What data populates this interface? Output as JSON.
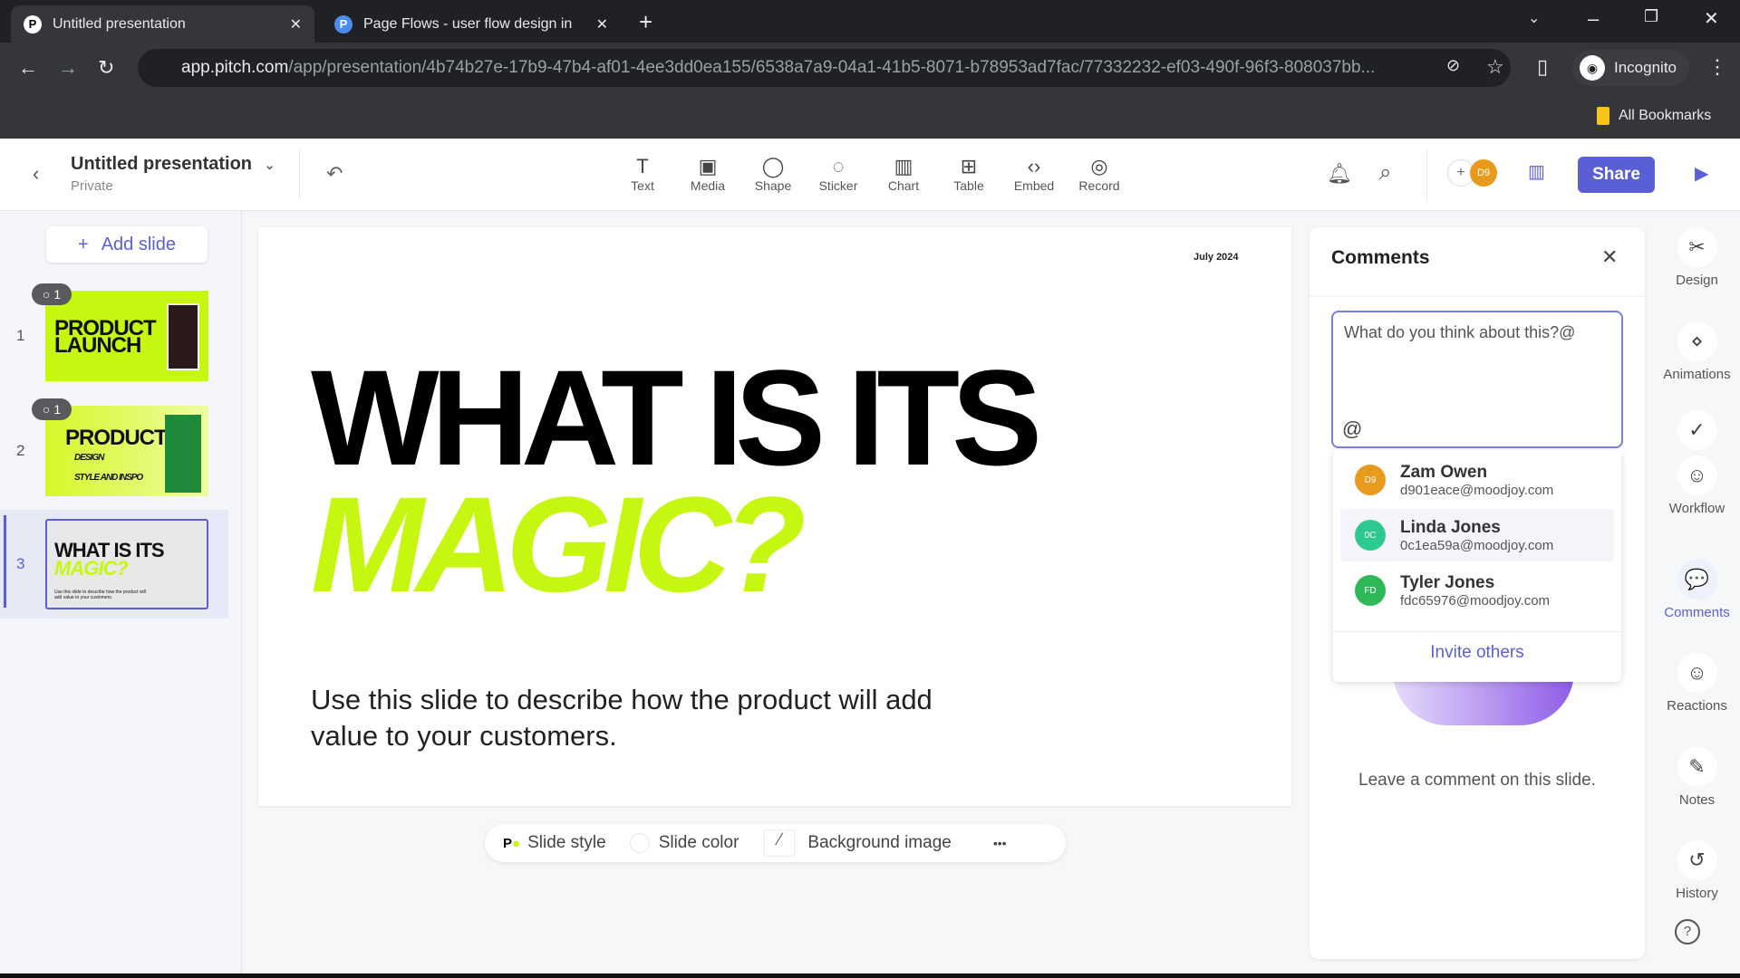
{
  "browser": {
    "tabs": [
      {
        "title": "Untitled presentation",
        "favicon": "P"
      },
      {
        "title": "Page Flows - user flow design in",
        "favicon": "P"
      }
    ],
    "url_host": "app.pitch.com",
    "url_path": "/app/presentation/4b74b27e-17b9-47b4-af01-4ee3dd0ea155/6538a7a9-04a1-41b5-8071-b78953ad7fac/77332232-ef03-490f-96f3-808037bb...",
    "profile": "Incognito",
    "bookmarks": "All Bookmarks"
  },
  "app": {
    "title": "Untitled presentation",
    "visibility": "Private",
    "tools": [
      {
        "label": "Text",
        "icon": "T"
      },
      {
        "label": "Media",
        "icon": "▣"
      },
      {
        "label": "Shape",
        "icon": "◯"
      },
      {
        "label": "Sticker",
        "icon": "◌"
      },
      {
        "label": "Chart",
        "icon": "▥"
      },
      {
        "label": "Table",
        "icon": "⊞"
      },
      {
        "label": "Embed",
        "icon": "‹›"
      },
      {
        "label": "Record",
        "icon": "◎"
      }
    ],
    "share": "Share",
    "avatar_initials": "D9",
    "accent": "#5b5fd6"
  },
  "sidebar": {
    "add_slide": "Add slide",
    "slides": [
      {
        "num": "1",
        "comments": "1",
        "title": "PRODUCT LAUNCH"
      },
      {
        "num": "2",
        "comments": "1",
        "title": "PRODUCT",
        "sub1": "DESIGN",
        "sub2": "STYLE AND INSPO"
      },
      {
        "num": "3",
        "title1": "WHAT IS ITS",
        "title2": "MAGIC?",
        "body": "Use this slide to describe how the product will add value to your customers."
      }
    ],
    "selected": 3
  },
  "slide": {
    "date": "July 2024",
    "heading1": "WHAT IS ITS",
    "heading2": "MAGIC?",
    "body": "Use this slide to describe how the product will add value to your customers.",
    "lime": "#c6f711"
  },
  "bottom_toolbar": {
    "slide_style": "Slide style",
    "slide_color": "Slide color",
    "background_image": "Background image",
    "more": "•••"
  },
  "comments": {
    "title": "Comments",
    "input_value": "What do you think about this?@",
    "at": "@",
    "mentions": [
      {
        "initials": "D9",
        "name": "Zam Owen",
        "email": "d901eace@moodjoy.com",
        "color": "#e89a1c"
      },
      {
        "initials": "0C",
        "name": "Linda Jones",
        "email": "0c1ea59a@moodjoy.com",
        "color": "#2ec98f"
      },
      {
        "initials": "FD",
        "name": "Tyler Jones",
        "email": "fdc65976@moodjoy.com",
        "color": "#2fb858"
      }
    ],
    "invite": "Invite others",
    "empty": "Leave a comment on this slide."
  },
  "rail": [
    {
      "label": "Design",
      "icon": "✂"
    },
    {
      "label": "Animations",
      "icon": "⋄"
    },
    {
      "label": "Workflow",
      "icon": "☺"
    },
    {
      "label": "Comments",
      "icon": "💬"
    },
    {
      "label": "Reactions",
      "icon": "☺"
    },
    {
      "label": "Notes",
      "icon": "✎"
    },
    {
      "label": "History",
      "icon": "↺"
    }
  ]
}
